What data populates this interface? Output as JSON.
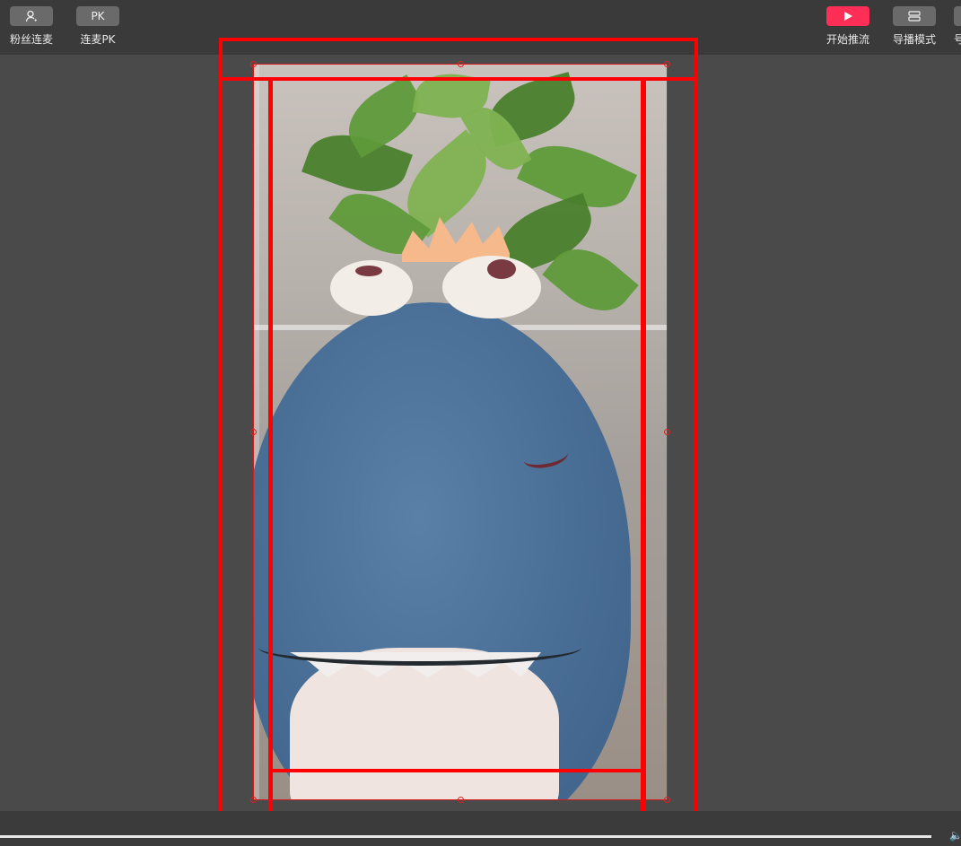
{
  "toolbar": {
    "left_tools": [
      {
        "label": "粉丝连麦",
        "icon": "person-icon"
      },
      {
        "label": "连麦PK",
        "icon_text": "PK"
      }
    ],
    "right_tools": [
      {
        "label": "开始推流",
        "icon": "play-icon"
      },
      {
        "label": "导播模式",
        "icon": "layout-icon"
      }
    ],
    "partial_tool_label": "号"
  },
  "colors": {
    "accent": "#ff2e57",
    "selection": "#ff0000",
    "background": "#4a4a4a",
    "toolbar": "#3a3a3a"
  },
  "preview": {
    "source": "camera-feed"
  },
  "icons": {
    "volume": "🔈"
  }
}
